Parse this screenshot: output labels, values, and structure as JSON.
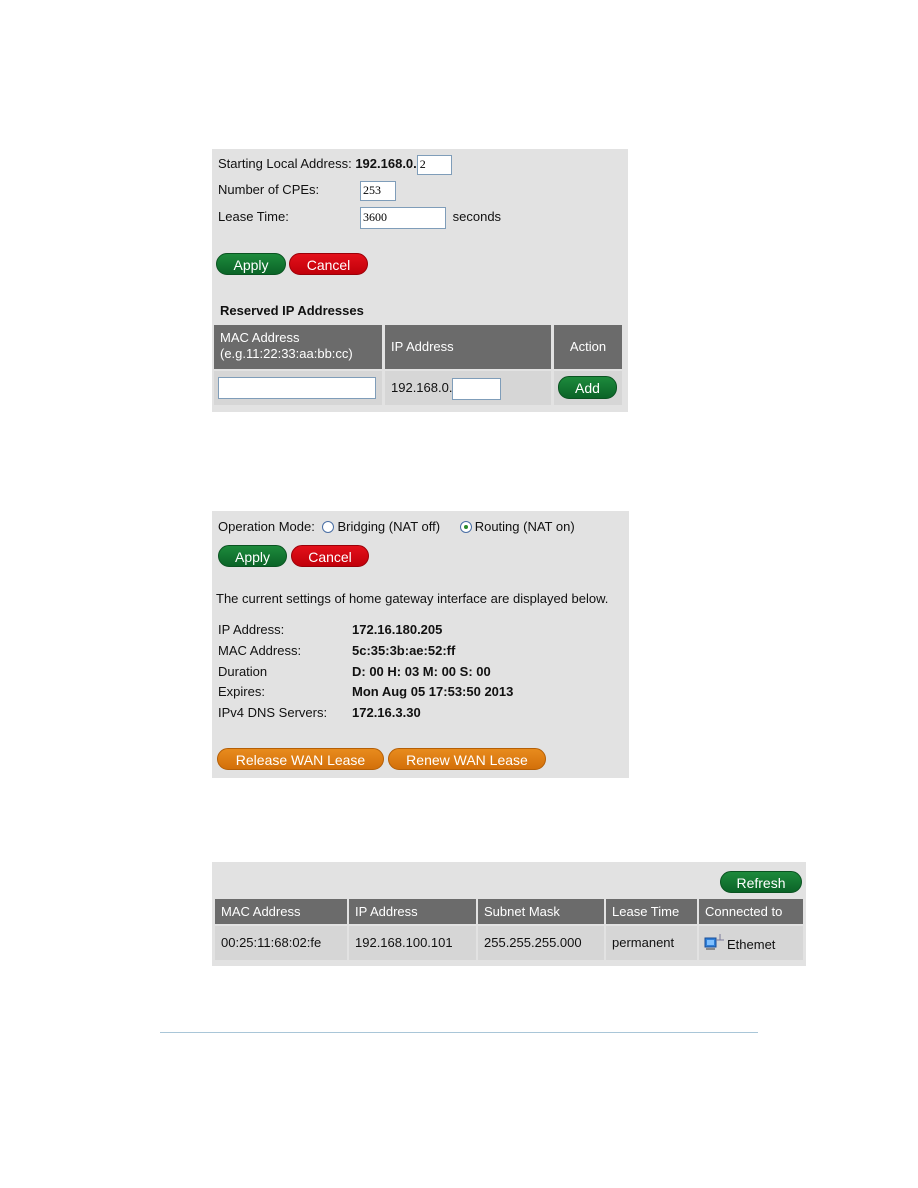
{
  "dhcp": {
    "starting_label": "Starting Local Address:",
    "starting_prefix": "192.168.0.",
    "starting_value": "2",
    "cpes_label": "Number of CPEs:",
    "cpes_value": "253",
    "lease_label": "Lease Time:",
    "lease_value": "3600",
    "lease_unit": "seconds",
    "apply_label": "Apply",
    "cancel_label": "Cancel",
    "reserved_title": "Reserved IP Addresses",
    "reserved_table": {
      "headers": [
        "MAC Address",
        "(e.g.11:22:33:aa:bb:cc)",
        "IP Address",
        "Action"
      ],
      "mac_value": "",
      "ip_prefix": "192.168.0.",
      "ip_value": "",
      "add_label": "Add"
    }
  },
  "wan": {
    "mode_label": "Operation Mode:",
    "mode_options": [
      {
        "label": "Bridging (NAT off)",
        "selected": false
      },
      {
        "label": "Routing (NAT on)",
        "selected": true
      }
    ],
    "apply_label": "Apply",
    "cancel_label": "Cancel",
    "description": "The current settings of home gateway interface are displayed below.",
    "fields": [
      {
        "label": "IP Address:",
        "value": "172.16.180.205"
      },
      {
        "label": "MAC Address:",
        "value": "5c:35:3b:ae:52:ff"
      },
      {
        "label": "Duration",
        "value": "D: 00 H: 03 M: 00 S: 00"
      },
      {
        "label": "Expires:",
        "value": "Mon Aug 05 17:53:50 2013"
      },
      {
        "label": "IPv4 DNS Servers:",
        "value": "172.16.3.30"
      }
    ],
    "release_label": "Release WAN Lease",
    "renew_label": "Renew WAN Lease"
  },
  "clients": {
    "refresh_label": "Refresh",
    "headers": [
      "MAC Address",
      "IP Address",
      "Subnet Mask",
      "Lease Time",
      "Connected to"
    ],
    "rows": [
      {
        "mac": "00:25:11:68:02:fe",
        "ip": "192.168.100.101",
        "mask": "255.255.255.000",
        "lease": "permanent",
        "connected": "Ethemet",
        "icon": "computer-network-icon"
      }
    ]
  }
}
